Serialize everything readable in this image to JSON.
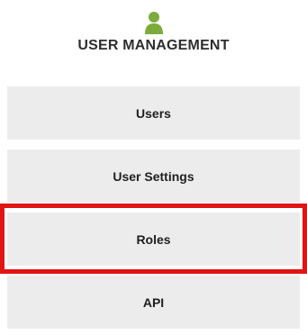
{
  "header": {
    "icon": "user-icon",
    "title": "USER MANAGEMENT",
    "icon_color": "#7cab3c"
  },
  "menu": {
    "items": [
      {
        "label": "Users"
      },
      {
        "label": "User Settings"
      },
      {
        "label": "Roles",
        "highlighted": true
      },
      {
        "label": "API"
      }
    ]
  },
  "colors": {
    "item_background": "#ececec",
    "highlight_border": "#e11414"
  }
}
